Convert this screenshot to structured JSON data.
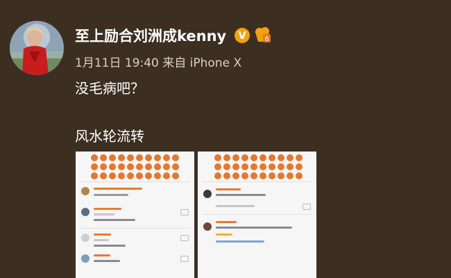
{
  "post": {
    "username": "至上励合刘洲成kenny",
    "verified_badge": "V",
    "level_icon": "vip-level-6-icon",
    "timestamp": "1月11日 19:40",
    "source_prefix": "来自",
    "source": "iPhone X",
    "line1": "没毛病吧？",
    "line2": "风水轮流转"
  },
  "colors": {
    "background": "#3d2e22",
    "text": "#ffffff",
    "meta_text": "#d8d0c8",
    "badge": "#f3a10e",
    "emoji": "#e7762f"
  },
  "attachments": [
    {
      "name": "screenshot-1",
      "content": "comment-thread-screenshot"
    },
    {
      "name": "screenshot-2",
      "content": "comment-thread-screenshot"
    }
  ]
}
